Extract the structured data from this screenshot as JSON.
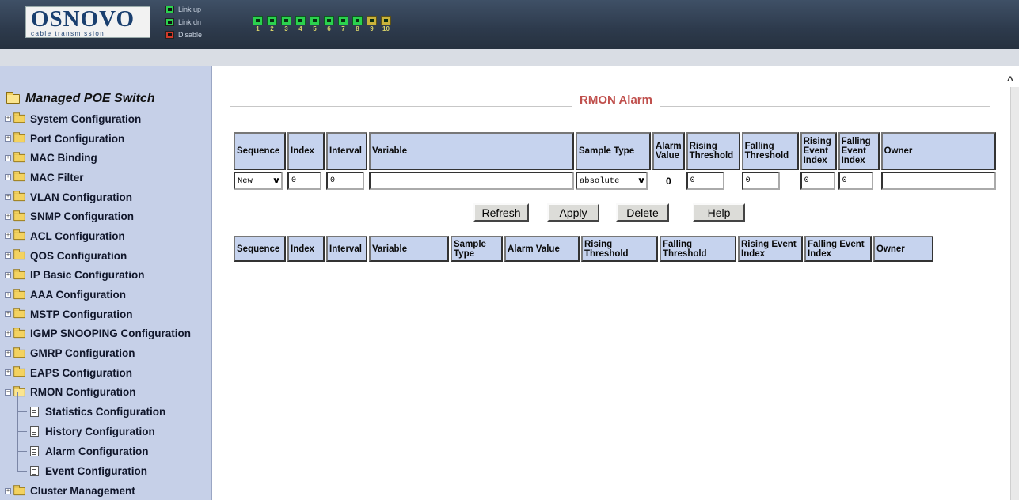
{
  "header": {
    "logo_main": "OSNOVO",
    "logo_sub": "cable transmission",
    "legend": [
      {
        "label": "Link up",
        "color": "#2bd14e"
      },
      {
        "label": "Link dn",
        "color": "#2bd14e"
      },
      {
        "label": "Disable",
        "color": "#d23a2a"
      }
    ],
    "ports": [
      "1",
      "2",
      "3",
      "4",
      "5",
      "6",
      "7",
      "8",
      "9",
      "10"
    ]
  },
  "sidebar": {
    "root": "Managed POE Switch",
    "items": [
      {
        "label": "System Configuration"
      },
      {
        "label": "Port Configuration"
      },
      {
        "label": "MAC Binding"
      },
      {
        "label": "MAC Filter"
      },
      {
        "label": "VLAN Configuration"
      },
      {
        "label": "SNMP Configuration"
      },
      {
        "label": "ACL Configuration"
      },
      {
        "label": "QOS Configuration"
      },
      {
        "label": "IP Basic Configuration"
      },
      {
        "label": "AAA Configuration"
      },
      {
        "label": "MSTP Configuration"
      },
      {
        "label": "IGMP SNOOPING Configuration"
      },
      {
        "label": "GMRP Configuration"
      },
      {
        "label": "EAPS Configuration"
      },
      {
        "label": "RMON Configuration"
      }
    ],
    "rmon_children": [
      {
        "label": "Statistics Configuration"
      },
      {
        "label": "History Configuration"
      },
      {
        "label": "Alarm Configuration"
      },
      {
        "label": "Event Configuration"
      }
    ],
    "last_item": "Cluster Management"
  },
  "main": {
    "title": "RMON Alarm",
    "form_table": {
      "headers": [
        "Sequence",
        "Index",
        "Interval",
        "Variable",
        "Sample Type",
        "Alarm Value",
        "Rising Threshold",
        "Falling Threshold",
        "Rising Event Index",
        "Falling Event Index",
        "Owner"
      ],
      "sequence_value": "New",
      "index_value": "0",
      "interval_value": "0",
      "variable_value": "",
      "sample_type_value": "absolute",
      "alarm_value": "0",
      "rising_threshold_value": "0",
      "falling_threshold_value": "0",
      "rising_event_index_value": "0",
      "falling_event_index_value": "0",
      "owner_value": ""
    },
    "buttons": {
      "refresh": "Refresh",
      "apply": "Apply",
      "delete": "Delete",
      "help": "Help"
    },
    "list_table": {
      "headers": [
        "Sequence",
        "Index",
        "Interval",
        "Variable",
        "Sample Type",
        "Alarm Value",
        "Rising Threshold",
        "Falling Threshold",
        "Rising Event Index",
        "Falling Event Index",
        "Owner"
      ]
    }
  }
}
